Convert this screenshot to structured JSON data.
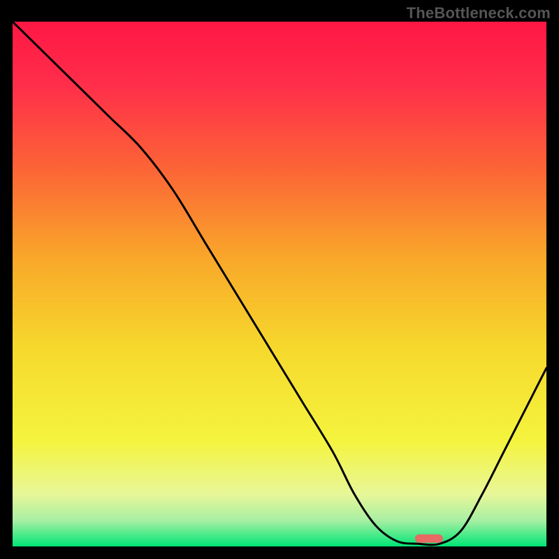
{
  "watermark": "TheBottleneck.com",
  "colors": {
    "background": "#000000",
    "curve": "#000000",
    "marker_fill": "#E76A64",
    "gradient_stops": [
      {
        "offset": 0.0,
        "color": "#FF1744"
      },
      {
        "offset": 0.12,
        "color": "#FF2E4A"
      },
      {
        "offset": 0.28,
        "color": "#FC6436"
      },
      {
        "offset": 0.45,
        "color": "#F9A72A"
      },
      {
        "offset": 0.62,
        "color": "#F6D82C"
      },
      {
        "offset": 0.8,
        "color": "#F4F43E"
      },
      {
        "offset": 0.9,
        "color": "#E8F798"
      },
      {
        "offset": 0.95,
        "color": "#A9EFA3"
      },
      {
        "offset": 1.0,
        "color": "#00E676"
      }
    ]
  },
  "chart_data": {
    "type": "line",
    "title": "",
    "xlabel": "",
    "ylabel": "",
    "xlim": [
      0,
      100
    ],
    "ylim": [
      0,
      100
    ],
    "x": [
      0,
      6,
      12,
      18,
      24,
      30,
      36,
      42,
      48,
      54,
      60,
      64,
      68,
      72,
      76,
      80,
      84,
      88,
      92,
      96,
      100
    ],
    "values": [
      100,
      94,
      88,
      82,
      76,
      68,
      58,
      48,
      38,
      28,
      18,
      10,
      4,
      1,
      0.5,
      0.5,
      3,
      10,
      18,
      26,
      34
    ],
    "marker": {
      "x": 78,
      "y": 1.5
    }
  }
}
